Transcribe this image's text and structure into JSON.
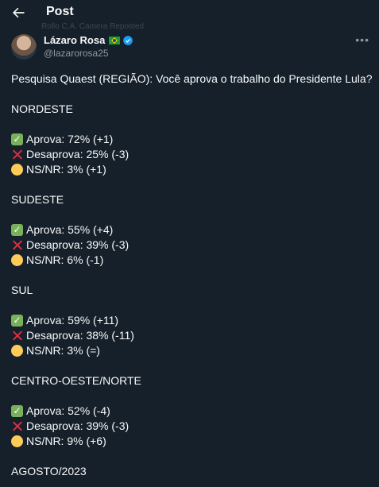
{
  "header": {
    "title": "Post",
    "ghost_text": "Rollo C.A. Camera Reposted"
  },
  "author": {
    "name": "Lázaro Rosa",
    "handle": "@lazarorosa25"
  },
  "post": {
    "intro": "Pesquisa Quaest (REGIÃO): Você aprova o trabalho do Presidente Lula?",
    "regions": [
      {
        "name": "NORDESTE",
        "aprova": "Aprova: 72% (+1)",
        "desaprova": "Desaprova: 25% (-3)",
        "nsnr": "NS/NR: 3% (+1)"
      },
      {
        "name": "SUDESTE",
        "aprova": "Aprova: 55% (+4)",
        "desaprova": "Desaprova: 39% (-3)",
        "nsnr": "NS/NR: 6% (-1)"
      },
      {
        "name": "SUL",
        "aprova": "Aprova: 59% (+11)",
        "desaprova": "Desaprova: 38% (-11)",
        "nsnr": "NS/NR: 3% (=)"
      },
      {
        "name": "CENTRO-OESTE/NORTE",
        "aprova": "Aprova: 52% (-4)",
        "desaprova": "Desaprova: 39% (-3)",
        "nsnr": "NS/NR: 9% (+6)"
      }
    ],
    "footer": "AGOSTO/2023"
  },
  "icons": {
    "back": "arrow-left-icon",
    "verified": "verified-badge-icon",
    "more": "more-icon",
    "check": "check-mark-icon",
    "cross": "cross-mark-icon",
    "circle": "yellow-circle-icon"
  },
  "colors": {
    "background": "#15202b",
    "text": "#f7f9f9",
    "muted": "#8b98a5",
    "verified": "#1d9bf0"
  }
}
